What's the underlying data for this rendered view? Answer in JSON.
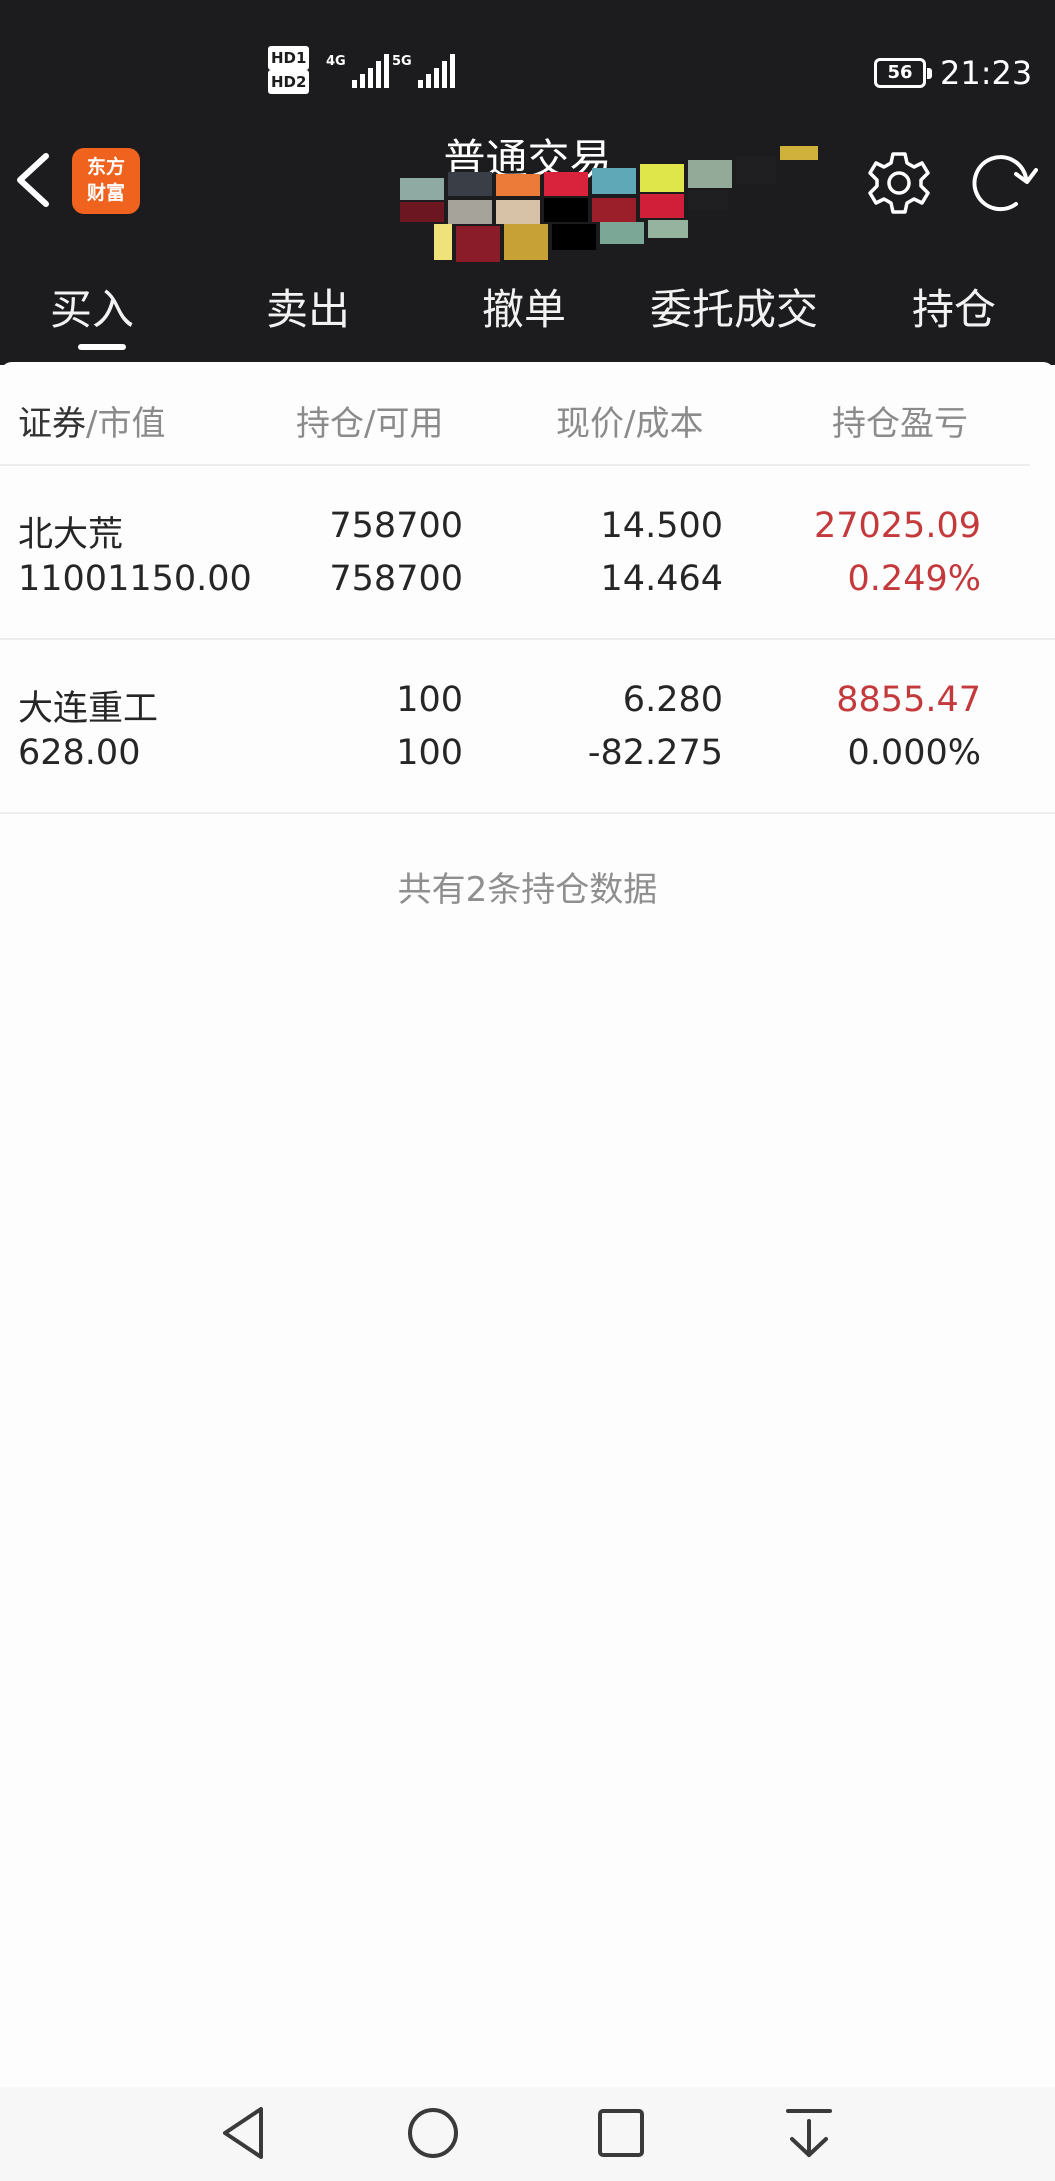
{
  "status_bar": {
    "sim1": "HD1",
    "sim2": "HD2",
    "net1": "4G",
    "net2": "5G",
    "battery": "56",
    "time": "21:23"
  },
  "header": {
    "logo_line1": "东方",
    "logo_line2": "财富",
    "title": "普通交易"
  },
  "tabs": [
    "买入",
    "卖出",
    "撤单",
    "委托成交",
    "持仓"
  ],
  "columns": {
    "col1_primary": "证券",
    "col1_secondary": "/市值",
    "col2": "持仓/可用",
    "col3": "现价/成本",
    "col4": "持仓盈亏"
  },
  "rows": [
    {
      "name": "北大荒",
      "market_value": "11001150.00",
      "position": "758700",
      "available": "758700",
      "price": "14.500",
      "cost": "14.464",
      "pnl": "27025.09",
      "pnl_pct": "0.249%"
    },
    {
      "name": "大连重工",
      "market_value": "628.00",
      "position": "100",
      "available": "100",
      "price": "6.280",
      "cost": "-82.275",
      "pnl": "8855.47",
      "pnl_pct": "0.000%"
    }
  ],
  "summary": "共有2条持仓数据",
  "colors": {
    "header_bg": "#1c1c1e",
    "profit_red": "#c4393b",
    "brand_orange": "#f0631f"
  }
}
